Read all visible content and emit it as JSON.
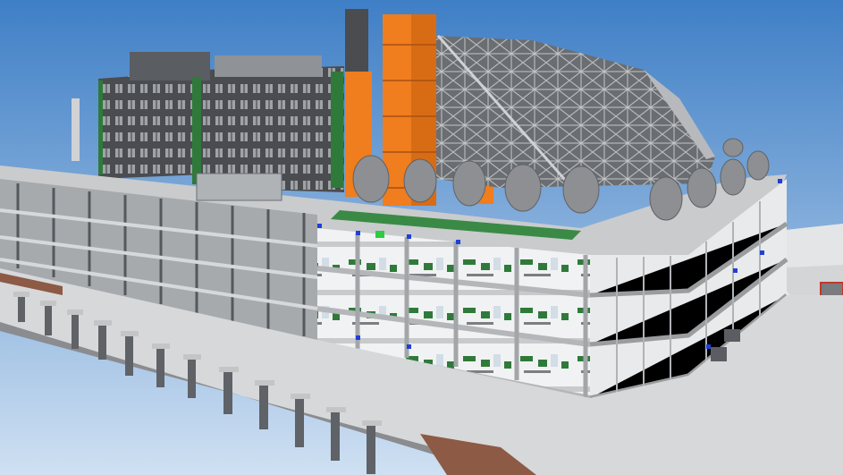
{
  "scene": {
    "subject": "bim-model-3d-view",
    "colors": {
      "sky_top": "#3f7fc6",
      "sky_bottom": "#c9dcf0",
      "slab": "#d9dadb",
      "slab_edge": "#9a9c9e",
      "frame": "#7b7e82",
      "dark_block": "#4a4c4f",
      "orange": "#f07d1e",
      "green": "#2f7a3a",
      "window": "#ffffff",
      "tree": "#8d8f92",
      "water_beam": "#8c5a45",
      "pier": "#5f6266"
    }
  }
}
